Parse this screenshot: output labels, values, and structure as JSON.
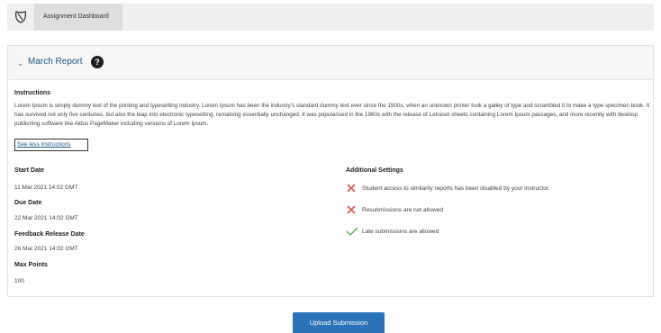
{
  "topbar": {
    "tab_label": "Assignment Dashboard"
  },
  "report": {
    "title": "March Report",
    "help_glyph": "?",
    "instructions_heading": "Instructions",
    "instructions_text": "Lorem Ipsum is simply dummy text of the printing and typesetting industry. Lorem Ipsum has been the industry's standard dummy text ever since the 1500s, when an unknown printer took a galley of type and scrambled it to make a type specimen book. It has survived not only five centuries, but also the leap into electronic typesetting, remaining essentially unchanged. It was popularised in the 1960s with the release of Letraset sheets containing Lorem Ipsum passages, and more recently with desktop publishing software like Aldus PageMaker including versions of Lorem Ipsum.",
    "see_less_label": "See less instructions",
    "start_date_label": "Start Date",
    "start_date": "11 Mar 2021 14:02 GMT",
    "due_date_label": "Due Date",
    "due_date": "22 Mar 2021 14:02 GMT",
    "feedback_label": "Feedback Release Date",
    "feedback_date": "26 Mar 2021 14:02 GMT",
    "max_points_label": "Max Points",
    "max_points": "100",
    "additional_settings_label": "Additional Settings",
    "settings": [
      {
        "text": "Student access to similarity reports has been disabled by your instructor.",
        "icon": "x-icon"
      },
      {
        "text": "Resubmissions are not allowed",
        "icon": "x-icon"
      },
      {
        "text": "Late submissions are allowed",
        "icon": "check-icon"
      }
    ]
  },
  "actions": {
    "upload_label": "Upload Submission"
  },
  "colors": {
    "accent": "#2b73b6",
    "title": "#1e5a82",
    "deny": "#d9534f",
    "allow": "#5cb85c"
  }
}
